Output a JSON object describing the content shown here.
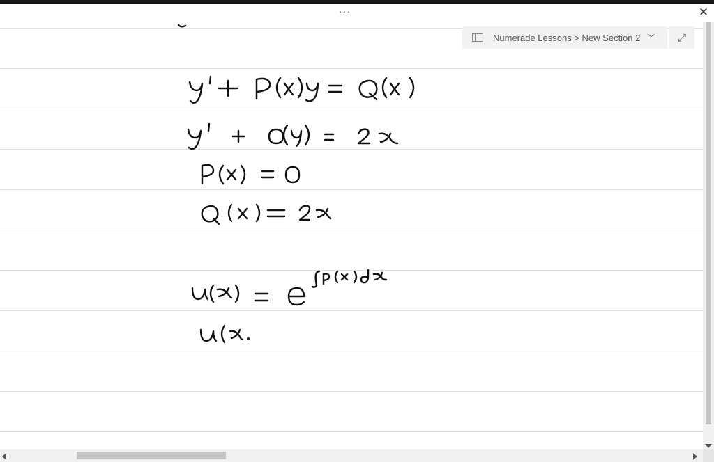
{
  "titlebar": {
    "more_label": "···",
    "close_label": "✕"
  },
  "navigation": {
    "breadcrumb": "Numerade Lessons > New Section 2",
    "dropdown_glyph": "﹀",
    "expand_glyph": "⤢"
  },
  "handwriting": {
    "line1": "y' + P(x) y = Q(x)",
    "line2": "y' + 0(y) = 2x",
    "line3": "P(x) = 0",
    "line4": "Q(x) = 2x",
    "line5": "u(x) = e^∫p(x)dx",
    "line6": "u(x"
  }
}
